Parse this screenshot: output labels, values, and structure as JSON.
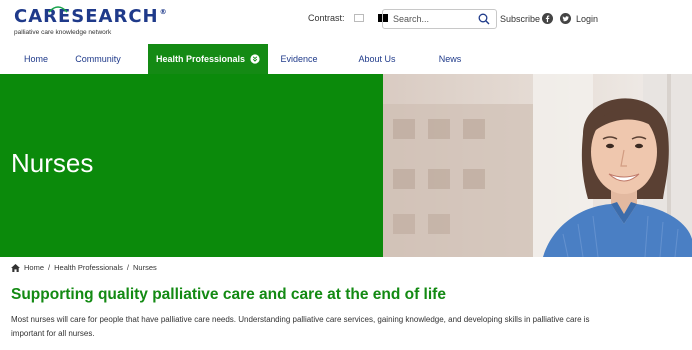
{
  "header": {
    "logo": {
      "care": "CARE",
      "search": "SEARCH",
      "reg": "®",
      "tagline": "palliative care knowledge network"
    },
    "contrast_label": "Contrast:",
    "search_placeholder": "Search...",
    "subscribe_label": "Subscribe",
    "login_label": "Login"
  },
  "nav": {
    "items": [
      {
        "label": "Home"
      },
      {
        "label": "Community"
      },
      {
        "label": "Health Professionals"
      },
      {
        "label": "Evidence"
      },
      {
        "label": "About Us"
      },
      {
        "label": "News"
      }
    ],
    "active_index": 2
  },
  "hero": {
    "title": "Nurses"
  },
  "breadcrumb": {
    "home": "Home",
    "sep1": "/",
    "section": "Health Professionals",
    "sep2": "/",
    "current": "Nurses"
  },
  "main": {
    "heading": "Supporting quality palliative care and care at the end of life",
    "intro": "Most nurses will care for people that have palliative care needs. Understanding palliative care services, gaining knowledge, and developing skills in palliative care is important for all nurses."
  },
  "colors": {
    "brand_green": "#0b8a0b",
    "brand_blue": "#1f3a8a"
  }
}
